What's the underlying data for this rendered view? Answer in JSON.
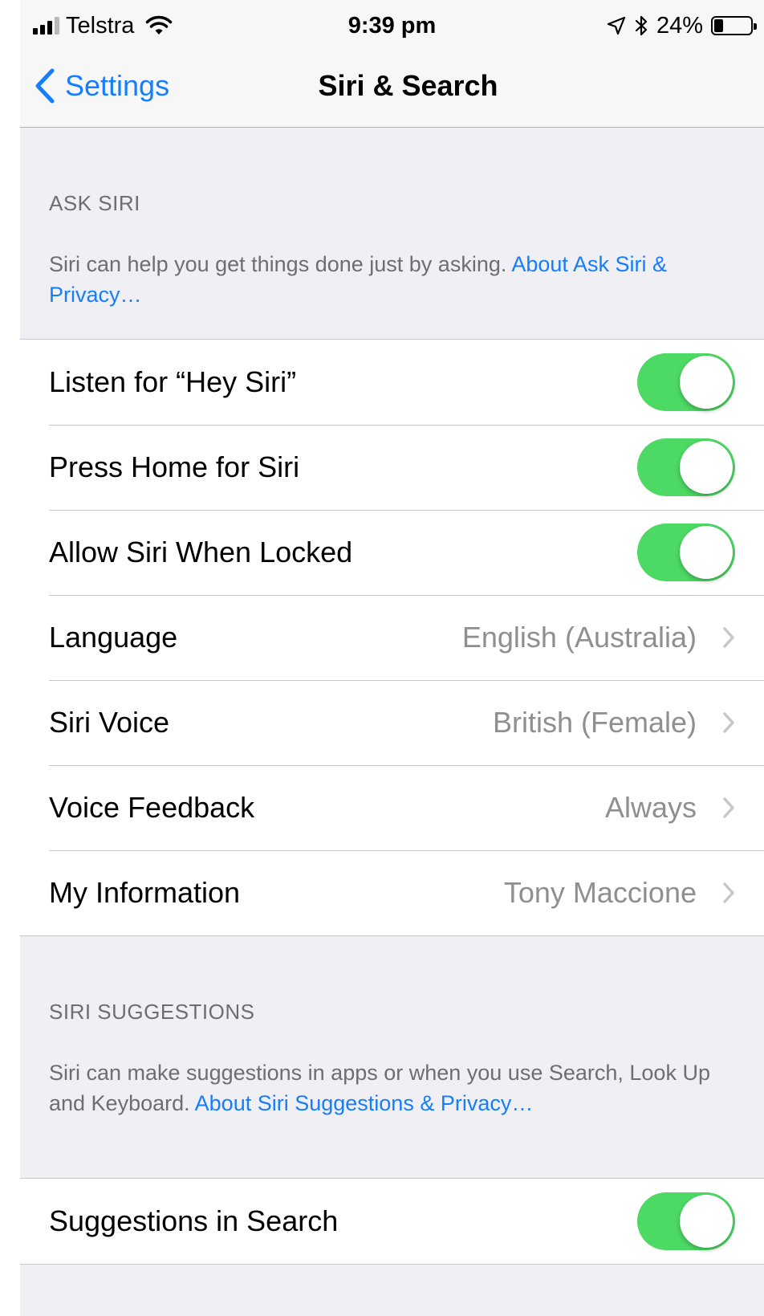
{
  "status_bar": {
    "carrier": "Telstra",
    "time": "9:39 pm",
    "battery_percent": "24%",
    "battery_level": 0.24,
    "signal_bars_filled": 3,
    "icons": [
      "signal-icon",
      "wifi-icon",
      "location-arrow-icon",
      "bluetooth-icon",
      "battery-icon"
    ]
  },
  "nav": {
    "back_label": "Settings",
    "title": "Siri & Search"
  },
  "ask_siri": {
    "header": "ASK SIRI",
    "footer_text": "Siri can help you get things done just by asking. ",
    "footer_link": "About Ask Siri & Privacy…",
    "rows": [
      {
        "label": "Listen for “Hey Siri”",
        "type": "toggle",
        "on": true
      },
      {
        "label": "Press Home for Siri",
        "type": "toggle",
        "on": true
      },
      {
        "label": "Allow Siri When Locked",
        "type": "toggle",
        "on": true
      },
      {
        "label": "Language",
        "type": "disclosure",
        "value": "English (Australia)"
      },
      {
        "label": "Siri Voice",
        "type": "disclosure",
        "value": "British (Female)"
      },
      {
        "label": "Voice Feedback",
        "type": "disclosure",
        "value": "Always"
      },
      {
        "label": "My Information",
        "type": "disclosure",
        "value": "Tony Maccione"
      }
    ]
  },
  "siri_suggestions": {
    "header": "SIRI SUGGESTIONS",
    "footer_text": "Siri can make suggestions in apps or when you use Search, Look Up and Keyboard. ",
    "footer_link": "About Siri Suggestions & Privacy…",
    "rows": [
      {
        "label": "Suggestions in Search",
        "type": "toggle",
        "on": true
      }
    ]
  },
  "colors": {
    "accent": "#157efb",
    "toggle_on": "#4cd964",
    "background": "#efeff4",
    "secondary_text": "#8e8e93"
  }
}
